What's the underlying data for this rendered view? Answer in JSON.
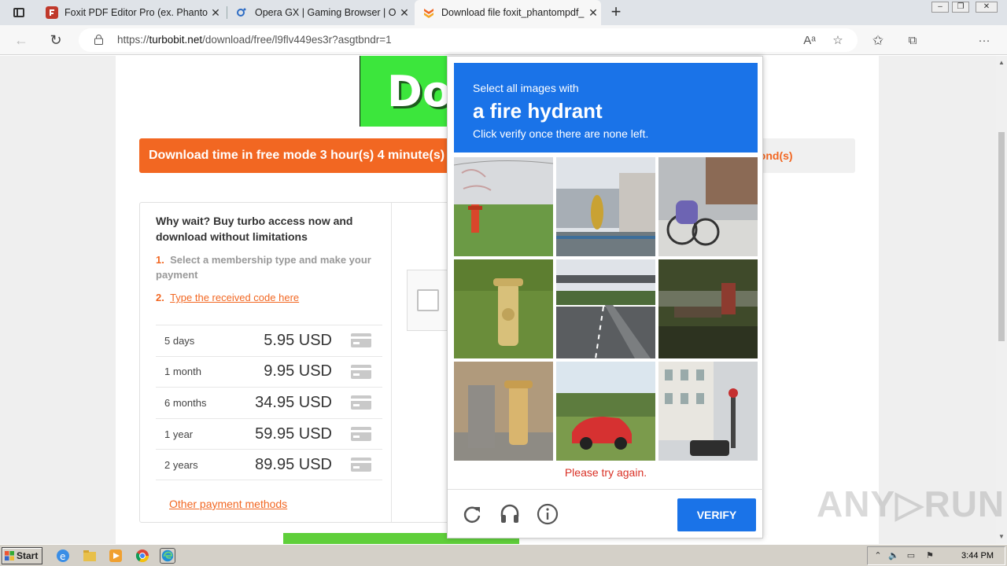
{
  "browser": {
    "tabs": [
      {
        "label": "Foxit PDF Editor Pro (ex. Phantom",
        "active": false
      },
      {
        "label": "Opera GX | Gaming Browser | Op",
        "active": false
      },
      {
        "label": "Download file foxit_phantompdf_",
        "active": true
      }
    ],
    "new_tab": "+",
    "url_prefix": "https://",
    "url_host": "turbobit.net",
    "url_path": "/download/free/l9flv449es3r?asgtbndr=1"
  },
  "page": {
    "banner_text": "Do",
    "timer_text": "Download time in free mode 3 hour(s) 4 minute(s)",
    "timer_right": "cond(s)",
    "buy_title": "Why wait? Buy turbo access now and download without limitations",
    "step1_num": "1.",
    "step1_text": "Select a membership type and make your payment",
    "step2_num": "2.",
    "step2_link": "Type the received code here",
    "prices": [
      {
        "duration": "5 days",
        "amount": "5.95 USD"
      },
      {
        "duration": "1 month",
        "amount": "9.95 USD"
      },
      {
        "duration": "6 months",
        "amount": "34.95 USD"
      },
      {
        "duration": "1 year",
        "amount": "59.95 USD"
      },
      {
        "duration": "2 years",
        "amount": "89.95 USD"
      }
    ],
    "other_payment": "Other payment methods"
  },
  "captcha": {
    "instruction_small": "Select all images with",
    "instruction_big": "a fire hydrant",
    "instruction_sub": "Click verify once there are none left.",
    "error": "Please try again.",
    "verify_label": "VERIFY",
    "tiles": [
      "wall-with-hydrant",
      "building-bridge",
      "bicycles",
      "yellow-hydrant",
      "highway",
      "park-bench",
      "hydrants-street",
      "red-car",
      "city-street"
    ]
  },
  "watermark": "ANY▷RUN",
  "taskbar": {
    "start_label": "Start",
    "clock": "3:44 PM"
  },
  "colors": {
    "accent_orange": "#f26722",
    "captcha_blue": "#1a73e8",
    "error_red": "#d93025",
    "banner_green": "#3ce63c"
  }
}
